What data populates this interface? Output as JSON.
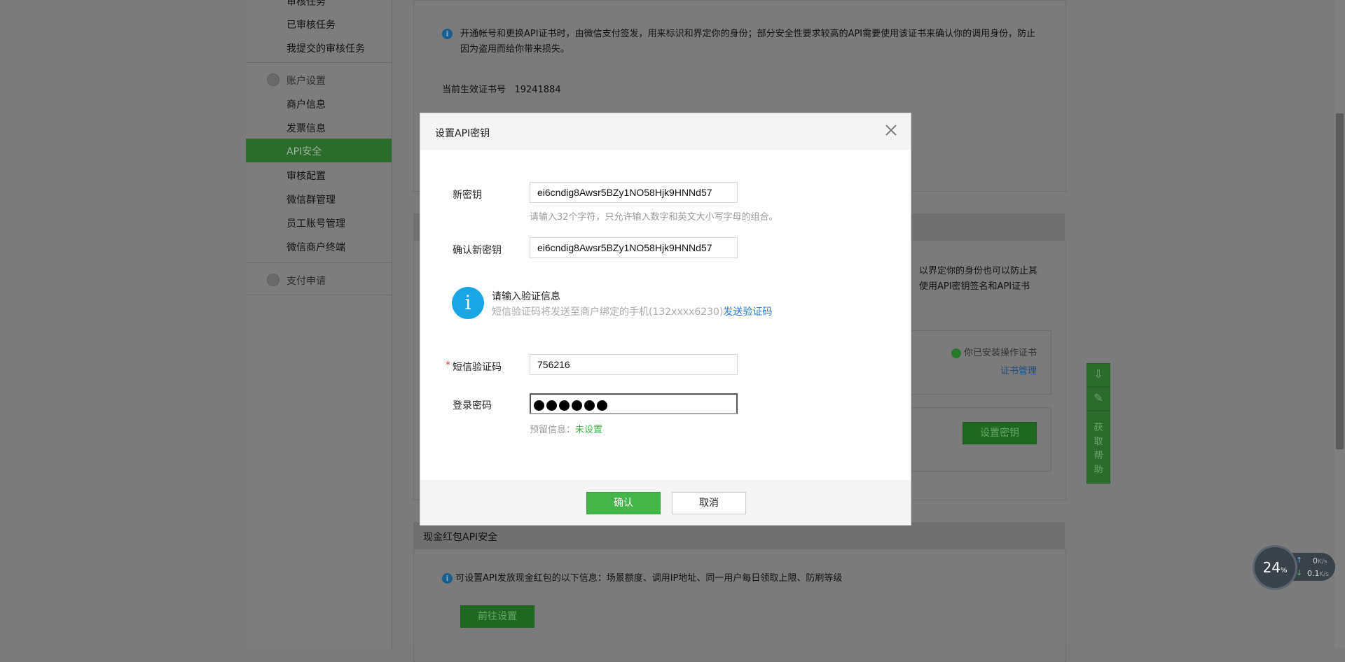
{
  "sidebar": {
    "items_top": [
      "审核任务",
      "已审核任务",
      "我提交的审核任务"
    ],
    "group_account": "账户设置",
    "account_items": [
      "商户信息",
      "发票信息",
      "API安全",
      "审核配置",
      "微信群管理",
      "员工账号管理",
      "微信商户终端"
    ],
    "active_item": "API安全",
    "group_pay": "支付申请"
  },
  "background": {
    "cert_notice": "开通帐号和更换API证书时，由微信支付签发，用来标识和界定你的身份；部分安全性要求较高的API需要使用该证书来确认你的调用身份，防止因为盗用而给你带来损失。",
    "cert_number_label": "当前生效证书号",
    "cert_number": "19241884",
    "right_text_1": "以界定你的身份也可以防止其",
    "right_text_2": "使用API密钥签名和API证书",
    "installed": "你已安装操作证书",
    "cert_manage": "证书管理",
    "set_key_button": "设置密钥",
    "redpack_title": "现金红包API安全",
    "redpack_notice": "可设置API发放现金红包的以下信息：场景额度、调用IP地址、同一用户每日领取上限、防刷等级",
    "goto_settings": "前往设置"
  },
  "tools": {
    "help": [
      "获",
      "取",
      "帮",
      "助"
    ]
  },
  "modal": {
    "title": "设置API密钥",
    "new_key_label": "新密钥",
    "new_key_value": "ei6cndig8Awsr5BZy1NO58Hjk9HNNd57",
    "new_key_hint": "请输入32个字符，只允许输入数字和英文大小写字母的组合。",
    "confirm_key_label": "确认新密钥",
    "confirm_key_value": "ei6cndig8Awsr5BZy1NO58Hjk9HNNd57",
    "verify_title": "请输入验证信息",
    "verify_desc": "短信验证码将发送至商户绑定的手机(132xxxx6230)",
    "send_code": "发送验证码",
    "sms_label": "短信验证码",
    "sms_required": "*",
    "sms_value": "756216",
    "password_label": "登录密码",
    "reserved_label": "预留信息：",
    "reserved_value": "未设置",
    "confirm_button": "确认",
    "cancel_button": "取消"
  },
  "speed_widget": {
    "percent": "24",
    "percent_unit": "%",
    "up": "0",
    "up_unit": "K/s",
    "down": "0.1",
    "down_unit": "K/s"
  }
}
